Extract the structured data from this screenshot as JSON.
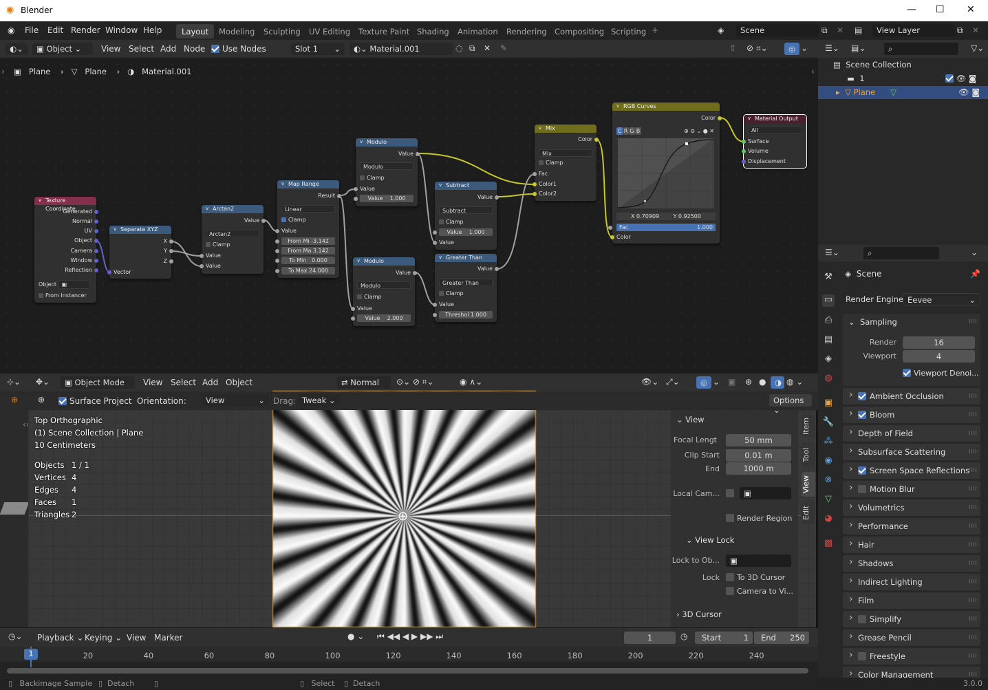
{
  "window": {
    "app_title": "Blender",
    "version": "3.0.0"
  },
  "menu": {
    "items": [
      "File",
      "Edit",
      "Render",
      "Window",
      "Help"
    ],
    "workspaces": [
      "Layout",
      "Modeling",
      "Sculpting",
      "UV Editing",
      "Texture Paint",
      "Shading",
      "Animation",
      "Rendering",
      "Compositing",
      "Scripting"
    ],
    "active_workspace": "Layout",
    "scene": "Scene",
    "view_layer": "View Layer"
  },
  "node_editor": {
    "header": {
      "mode": "Object",
      "menus": [
        "View",
        "Select",
        "Add",
        "Node"
      ],
      "use_nodes_label": "Use Nodes",
      "use_nodes": true,
      "slot": "Slot 1",
      "material": "Material.001"
    },
    "breadcrumb": [
      "Plane",
      "Plane",
      "Material.001"
    ],
    "nodes": {
      "tex_coord": {
        "title": "Texture Coordinate",
        "outputs": [
          "Generated",
          "Normal",
          "UV",
          "Object",
          "Camera",
          "Window",
          "Reflection"
        ],
        "object_label": "Object",
        "from_instancer": "From Instancer"
      },
      "sep_xyz": {
        "title": "Separate XYZ",
        "outputs": [
          "X",
          "Y",
          "Z"
        ],
        "input": "Vector"
      },
      "arctan2": {
        "title": "Arctan2",
        "output": "Value",
        "op": "Arctan2",
        "clamp": "Clamp",
        "inputs": [
          "Value",
          "Value"
        ]
      },
      "map_range": {
        "title": "Map Range",
        "output": "Result",
        "interp": "Linear",
        "clamp": "Clamp",
        "input": "Value",
        "fields": [
          {
            "label": "From Mi",
            "value": "-3.142"
          },
          {
            "label": "From Ma",
            "value": "3.142"
          },
          {
            "label": "To Min",
            "value": "0.000"
          },
          {
            "label": "To Max",
            "value": "24.000"
          }
        ]
      },
      "modulo1": {
        "title": "Modulo",
        "output": "Value",
        "op": "Modulo",
        "clamp": "Clamp",
        "input": "Value",
        "field_label": "Value",
        "field_value": "1.000"
      },
      "modulo2": {
        "title": "Modulo",
        "output": "Value",
        "op": "Modulo",
        "clamp": "Clamp",
        "input": "Value",
        "field_label": "Value",
        "field_value": "2.000"
      },
      "subtract": {
        "title": "Subtract",
        "output": "Value",
        "op": "Subtract",
        "clamp": "Clamp",
        "field_label": "Value",
        "field_value": "1.000",
        "input": "Value"
      },
      "greater": {
        "title": "Greater Than",
        "output": "Value",
        "op": "Greater Than",
        "clamp": "Clamp",
        "input": "Value",
        "field_label": "Threshol",
        "field_value": "1.000"
      },
      "mix": {
        "title": "Mix",
        "output": "Color",
        "op": "Mix",
        "clamp": "Clamp",
        "inputs": [
          "Fac",
          "Color1",
          "Color2"
        ]
      },
      "curves": {
        "title": "RGB Curves",
        "output": "Color",
        "channels": [
          "C",
          "R",
          "G",
          "B"
        ],
        "x": "X 0.70909",
        "y": "Y 0.92500",
        "fac_label": "Fac",
        "fac_value": "1.000",
        "input": "Color"
      },
      "output": {
        "title": "Material Output",
        "target": "All",
        "inputs": [
          "Surface",
          "Volume",
          "Displacement"
        ]
      }
    }
  },
  "outliner": {
    "root": "Scene Collection",
    "collection": "1",
    "object": "Plane"
  },
  "properties": {
    "scene": "Scene",
    "render_engine_label": "Render Engine",
    "render_engine": "Eevee",
    "sampling": {
      "title": "Sampling",
      "render_label": "Render",
      "render": "16",
      "viewport_label": "Viewport",
      "viewport": "4",
      "denoise": "Viewport Denoi..."
    },
    "panels": [
      {
        "label": "Ambient Occlusion",
        "check": true
      },
      {
        "label": "Bloom",
        "check": true
      },
      {
        "label": "Depth of Field"
      },
      {
        "label": "Subsurface Scattering"
      },
      {
        "label": "Screen Space Reflections",
        "check": true
      },
      {
        "label": "Motion Blur",
        "check": false
      },
      {
        "label": "Volumetrics"
      },
      {
        "label": "Performance"
      },
      {
        "label": "Hair"
      },
      {
        "label": "Shadows"
      },
      {
        "label": "Indirect Lighting"
      },
      {
        "label": "Film"
      },
      {
        "label": "Simplify",
        "check": false
      },
      {
        "label": "Grease Pencil"
      },
      {
        "label": "Freestyle",
        "check": false
      },
      {
        "label": "Color Management"
      }
    ]
  },
  "viewport": {
    "header": {
      "mode": "Object Mode",
      "menus": [
        "View",
        "Select",
        "Add",
        "Object"
      ],
      "orientation": "Normal"
    },
    "tool": {
      "surface_project": "Surface Project",
      "orientation_label": "Orientation:",
      "orientation": "View",
      "drag_label": "Drag:",
      "drag": "Tweak",
      "options": "Options"
    },
    "overlay": {
      "view_name": "Top Orthographic",
      "collection": "(1) Scene Collection | Plane",
      "scale": "10 Centimeters",
      "stats": [
        {
          "k": "Objects",
          "v": "1 / 1"
        },
        {
          "k": "Vertices",
          "v": "4"
        },
        {
          "k": "Edges",
          "v": "4"
        },
        {
          "k": "Faces",
          "v": "1"
        },
        {
          "k": "Triangles",
          "v": "2"
        }
      ]
    },
    "npanel": {
      "view": "View",
      "focal_label": "Focal Lengt",
      "focal": "50 mm",
      "clip_start_label": "Clip Start",
      "clip_start": "0.01 m",
      "end_label": "End",
      "end": "1000 m",
      "local_cam": "Local Cam...",
      "render_region": "Render Region",
      "view_lock": "View Lock",
      "lock_obj": "Lock to Ob...",
      "lock": "Lock",
      "to_cursor": "To 3D Cursor",
      "cam_to_view": "Camera to Vi...",
      "cursor": "3D Cursor"
    },
    "tabs": [
      "Item",
      "Tool",
      "View",
      "Edit"
    ]
  },
  "timeline": {
    "menus": [
      "Playback",
      "Keying",
      "View",
      "Marker"
    ],
    "current": "1",
    "start_label": "Start",
    "start": "1",
    "end_label": "End",
    "end": "250",
    "ticks": [
      "20",
      "40",
      "60",
      "80",
      "100",
      "120",
      "140",
      "160",
      "180",
      "200",
      "220",
      "240"
    ]
  },
  "status": {
    "items": [
      "Backimage Sample",
      "Detach",
      "Select",
      "Detach"
    ]
  }
}
